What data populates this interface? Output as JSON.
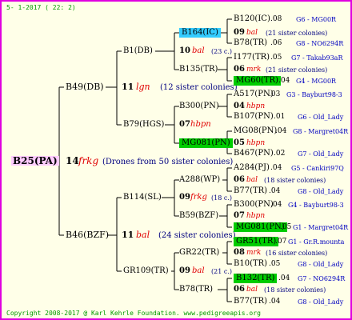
{
  "header": {
    "date": "5- 1-2017 ( 22: 2)"
  },
  "footer": {
    "copyright": "Copyright 2008-2017 @ Karl Kehrle Foundation.   www.pedigreeapis.org"
  },
  "colors": {
    "border": "#e000e0",
    "bg": "#ffffe8",
    "cyan": "#33ccff",
    "green": "#00cc00",
    "pink": "#ffccff",
    "red": "#e00000",
    "blue": "#0000c0",
    "green_text": "#009900"
  },
  "root": {
    "name": "B25(PA)",
    "yr": "14",
    "code": "frkg",
    "desc": "(Drones from 50 sister colonies)"
  },
  "p": {
    "name": "B49(DB)",
    "yr": "11",
    "code": "lgn",
    "desc": "(12 sister colonies)",
    "pp": {
      "name": "B1(DB)",
      "yr": "10",
      "code": "bal",
      "desc": "(23 c.)",
      "ppp": {
        "name": "B164(IC)",
        "yr": "09",
        "code": "bal",
        "desc": "(21 sister colonies)",
        "p4": {
          "name": "B120(IC)",
          "num": ".08",
          "info": "G6 - MG00R"
        },
        "m4": {
          "name": "B78(TR)",
          "num": ".06",
          "info": "G8 - NO6294R"
        }
      },
      "ppm": {
        "name": "B135(TR)",
        "yr": "06",
        "code": "mrk",
        "desc": "(21 sister colonies)",
        "p4": {
          "name": "I177(TR)",
          "num": ".05",
          "info": "G7 - Takab93aR"
        },
        "m4": {
          "name": "MG60(TR)",
          "num": ".04",
          "info": "G4 - MG00R"
        }
      }
    },
    "pm": {
      "name": "B79(HGS)",
      "yr": "07",
      "code": "hbpn",
      "desc": "",
      "pmp": {
        "name": "B300(PN)",
        "yr": "04",
        "code": "hbpn",
        "desc": "",
        "p4": {
          "name": "A517(PN)",
          "num": ".03",
          "info": "G3 - Bayburt98-3"
        },
        "m4": {
          "name": "B107(PN)",
          "num": ".01",
          "info": "G6 - Old_Lady"
        }
      },
      "pmm": {
        "name": "MG081(PN)",
        "yr": "05",
        "code": "hbpn",
        "desc": "",
        "p4": {
          "name": "MG08(PN)",
          "num": ".04",
          "info": "G8 - Margret04R"
        },
        "m4": {
          "name": "B467(PN)",
          "num": ".02",
          "info": "G7 - Old_Lady"
        }
      }
    }
  },
  "m": {
    "name": "B46(BZF)",
    "yr": "11",
    "code": "bal",
    "desc": "(24 sister colonies)",
    "mp": {
      "name": "B114(SL)",
      "yr": "09",
      "code": "frkg",
      "desc": "(18 c.)",
      "mpp": {
        "name": "A288(WP)",
        "yr": "06",
        "code": "bal",
        "desc": "(18 sister colonies)",
        "p4": {
          "name": "A284(PJ)",
          "num": ".04",
          "info": "G5 - Cankiri97Q"
        },
        "m4": {
          "name": "B77(TR)",
          "num": ".04",
          "info": "G8 - Old_Lady"
        }
      },
      "mpm": {
        "name": "B59(BZF)",
        "yr": "07",
        "code": "hbpn",
        "desc": "",
        "p4": {
          "name": "B300(PN)",
          "num": ".04",
          "info": "G4 - Bayburt98-3"
        },
        "m4": {
          "name": "MG081(PN)",
          "num": ".05",
          "info": "G1 - Margret04R"
        }
      }
    },
    "mm": {
      "name": "GR109(TR)",
      "yr": "09",
      "code": "bal",
      "desc": "(21 c.)",
      "mmp": {
        "name": "GR22(TR)",
        "yr": "08",
        "code": "mrk",
        "desc": "(16 sister colonies)",
        "p4": {
          "name": "GR51(TR)",
          "num": ".07",
          "info": "G1 - Gr.R.mounta"
        },
        "m4": {
          "name": "B10(TR)",
          "num": ".05",
          "info": "G8 - Old_Lady"
        }
      },
      "mmm": {
        "name": "B78(TR)",
        "yr": "06",
        "code": "bal",
        "desc": "(18 sister colonies)",
        "p4": {
          "name": "B132(TR)",
          "num": ".04",
          "info": "G7 - NO6294R"
        },
        "m4": {
          "name": "B77(TR)",
          "num": ".04",
          "info": "G8 - Old_Lady"
        }
      }
    }
  }
}
